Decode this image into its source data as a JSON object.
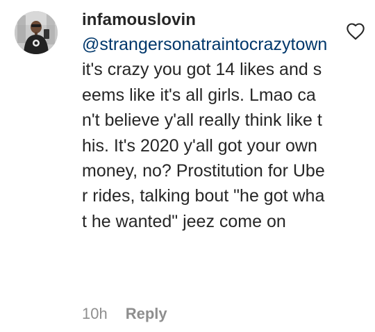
{
  "comment": {
    "username": "infamouslovin",
    "mention": "@strangersonatraintocrazytown",
    "text": " it's crazy you got 14 likes and seems like it's all girls. Lmao can't believe y'all really think like this. It's 2020 y'all got your own money, no? Prostitution for Uber rides, talking bout \"he got what he wanted\" jeez come on",
    "timestamp": "10h",
    "reply_label": "Reply",
    "like_icon": "heart-outline-icon"
  },
  "colors": {
    "text": "#262626",
    "mention": "#00376b",
    "meta": "#8e8e8e",
    "background": "#ffffff"
  }
}
